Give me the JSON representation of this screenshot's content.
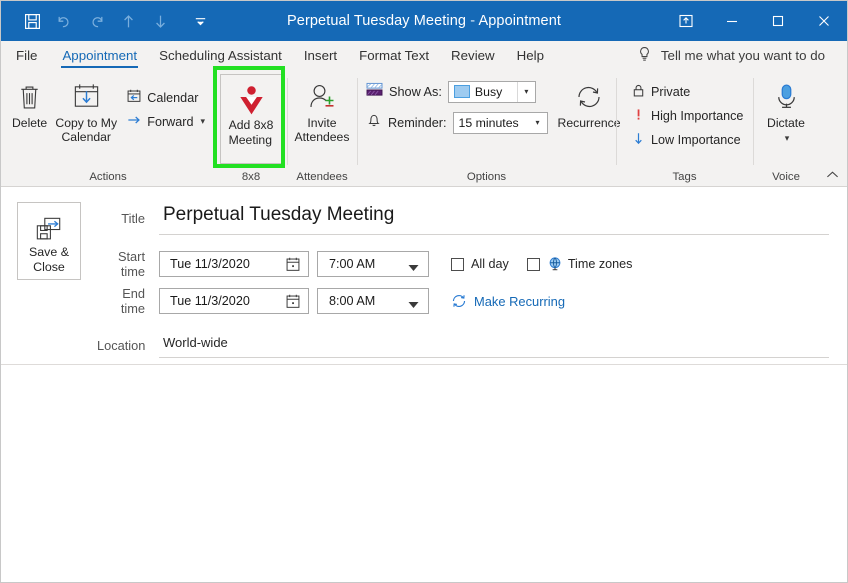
{
  "window": {
    "title_main": "Perpetual Tuesday Meeting",
    "title_sep": "-",
    "title_kind": "Appointment"
  },
  "quick_access": {
    "save": "save-icon",
    "undo": "undo-icon",
    "redo": "redo-icon",
    "previous": "up-arrow-icon",
    "next": "down-arrow-icon",
    "customize": "customize-qat-icon"
  },
  "window_controls": {
    "ribbon_display": "ribbon-display-options",
    "minimize": "Minimize",
    "maximize": "Maximize",
    "close": "Close"
  },
  "tabs": [
    {
      "label": "File",
      "active": false
    },
    {
      "label": "Appointment",
      "active": true
    },
    {
      "label": "Scheduling Assistant",
      "active": false
    },
    {
      "label": "Insert",
      "active": false
    },
    {
      "label": "Format Text",
      "active": false
    },
    {
      "label": "Review",
      "active": false
    },
    {
      "label": "Help",
      "active": false
    }
  ],
  "tell_me": {
    "label": "Tell me what you want to do",
    "icon": "lightbulb-icon"
  },
  "ribbon": {
    "groups": [
      {
        "name": "actions",
        "label": "Actions",
        "big_buttons": [
          {
            "label": "Delete",
            "icon": "trash-icon"
          },
          {
            "label": "Copy to My\nCalendar",
            "line1": "Copy to My",
            "line2": "Calendar",
            "icon": "copy-to-calendar-icon"
          }
        ],
        "small_buttons": [
          {
            "label": "Calendar",
            "icon": "calendar-back-icon",
            "has_chevron": false
          },
          {
            "label": "Forward",
            "icon": "forward-arrow-icon",
            "has_chevron": true
          }
        ]
      },
      {
        "name": "8x8",
        "label": "8x8",
        "highlighted": true,
        "button": {
          "line1": "Add 8x8",
          "line2": "Meeting",
          "icon": "8x8-logo-icon"
        }
      },
      {
        "name": "attendees",
        "label": "Attendees",
        "button": {
          "line1": "Invite",
          "line2": "Attendees",
          "icon": "invite-attendees-icon"
        }
      },
      {
        "name": "options",
        "label": "Options",
        "show_as": {
          "label": "Show As:",
          "value": "Busy",
          "icon": "show-as-icon"
        },
        "reminder": {
          "label": "Reminder:",
          "value": "15 minutes",
          "icon": "bell-icon"
        },
        "recurrence": {
          "label": "Recurrence",
          "icon": "recurrence-icon"
        }
      },
      {
        "name": "tags",
        "label": "Tags",
        "items": [
          {
            "label": "Private",
            "icon": "lock-icon"
          },
          {
            "label": "High Importance",
            "icon": "exclamation-icon"
          },
          {
            "label": "Low Importance",
            "icon": "down-arrow-blue-icon"
          }
        ]
      },
      {
        "name": "voice",
        "label": "Voice",
        "button": {
          "label": "Dictate",
          "icon": "microphone-icon",
          "has_chevron": true
        }
      }
    ],
    "collapse_icon": "chevron-up-icon"
  },
  "form": {
    "save_close": {
      "line1": "Save &",
      "line2": "Close",
      "icon": "save-close-icon"
    },
    "title": {
      "label": "Title",
      "value": "Perpetual Tuesday Meeting"
    },
    "start_time": {
      "label": "Start time",
      "date": "Tue 11/3/2020",
      "time": "7:00 AM"
    },
    "end_time": {
      "label": "End time",
      "date": "Tue 11/3/2020",
      "time": "8:00 AM"
    },
    "all_day": {
      "label": "All day",
      "checked": false
    },
    "time_zones": {
      "label": "Time zones",
      "checked": false,
      "icon": "globe-icon"
    },
    "make_recurring": {
      "label": "Make Recurring",
      "icon": "recurrence-small-icon"
    },
    "location": {
      "label": "Location",
      "value": "World-wide"
    }
  },
  "colors": {
    "titlebar": "#1569b6",
    "accent": "#1569b6",
    "ribbon_bg": "#f3f2f1",
    "highlight": "#22e022",
    "logo_red": "#cf2030",
    "high_importance": "#e04040",
    "low_importance": "#2b7cd3"
  }
}
